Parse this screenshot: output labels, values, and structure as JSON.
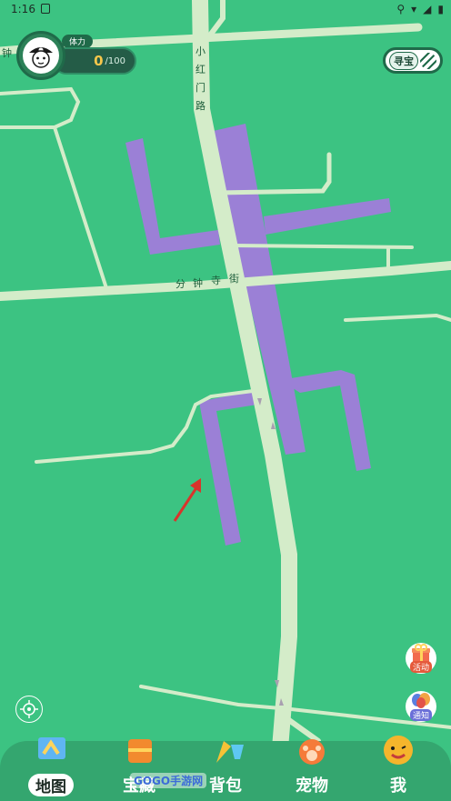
{
  "status": {
    "time": "1:16"
  },
  "map": {
    "edge_label": "钟",
    "road_north": [
      "小",
      "红",
      "门",
      "路"
    ],
    "road_cross": [
      "分",
      "钟",
      "寺",
      "街"
    ]
  },
  "stamina": {
    "label": "体力",
    "value": "0",
    "max": "/100"
  },
  "toggle": {
    "label": "寻宝"
  },
  "floating": {
    "activity": "活动",
    "notice": "通知"
  },
  "nav": {
    "items": [
      {
        "label": "地图",
        "active": true
      },
      {
        "label": "宝藏"
      },
      {
        "label": "背包"
      },
      {
        "label": "宠物"
      },
      {
        "label": "我"
      }
    ]
  },
  "watermark": "GOGO手游网",
  "colors": {
    "map_bg": "#3cc382",
    "road": "#d4ecc9",
    "building": "#9b80d6",
    "nav_bg": "#34a66f",
    "arrow": "#d9342b"
  }
}
